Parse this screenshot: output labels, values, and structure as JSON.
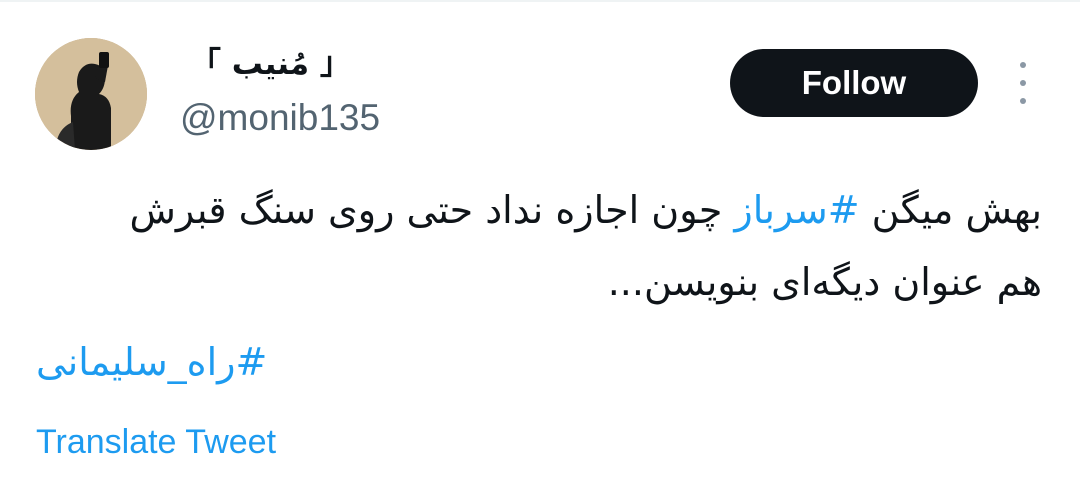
{
  "author": {
    "display_name": "「 مُنیب 」",
    "handle": "@monib135"
  },
  "actions": {
    "follow_label": "Follow",
    "more_icon": "more-vertical-icon"
  },
  "tweet": {
    "text_before": "بهش میگن ",
    "hashtag_inline": "#سرباز",
    "text_after": " چون اجازه نداد حتی روی سنگ قبرش هم عنوان دیگه‌ای بنویسن...",
    "hashtag_footer": "#راه_سلیمانی",
    "translate_label": "Translate Tweet"
  },
  "colors": {
    "accent": "#1d9bf0",
    "text": "#0f1419",
    "secondary": "#536471",
    "button_bg": "#0f1419"
  }
}
